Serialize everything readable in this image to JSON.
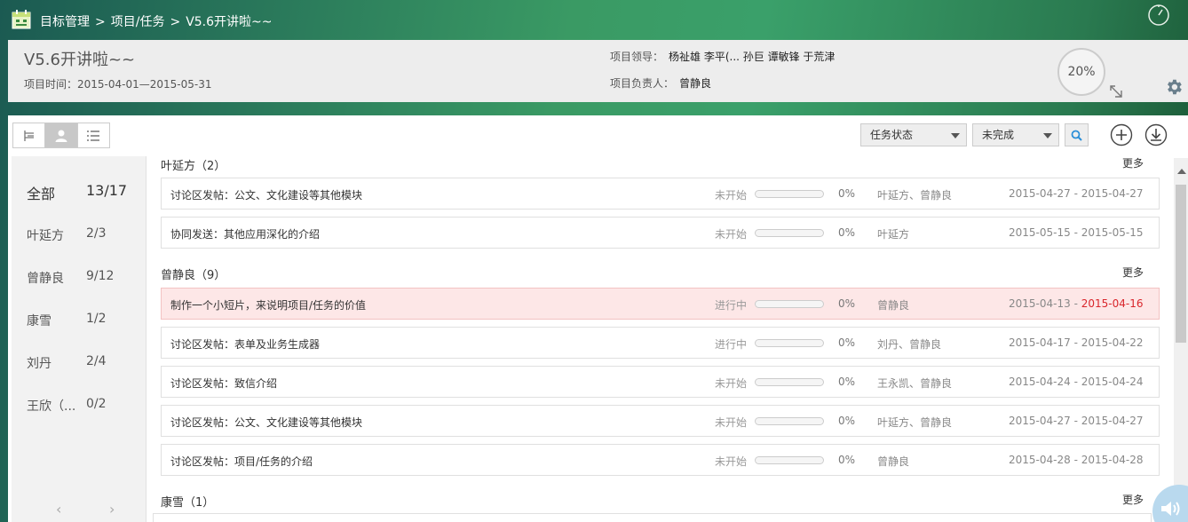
{
  "breadcrumb": {
    "root": "目标管理",
    "sep1": ">",
    "mid": "项目/任务",
    "sep2": ">",
    "current": "V5.6开讲啦~~"
  },
  "header": {
    "title": "V5.6开讲啦~~",
    "time": "项目时间：2015-04-01—2015-05-31",
    "leaders_label": "项目领导：",
    "leaders": "杨祉雄 李平(... 孙巨 谭敏锋 于荒津",
    "owner_label": "项目负责人：",
    "owner": "曾静良",
    "progress": "20%"
  },
  "toolbar": {
    "status_filter": "任务状态",
    "done_filter": "未完成"
  },
  "sidebar": {
    "items": [
      {
        "name": "全部",
        "count": "13/17"
      },
      {
        "name": "叶延方",
        "count": "2/3"
      },
      {
        "name": "曾静良",
        "count": "9/12"
      },
      {
        "name": "康雪",
        "count": "1/2"
      },
      {
        "name": "刘丹",
        "count": "2/4"
      },
      {
        "name": "王欣（...",
        "count": "0/2"
      }
    ],
    "prev": "‹",
    "next": "›"
  },
  "groups": [
    {
      "title": "叶延方（2）",
      "more": "更多",
      "rows": [
        {
          "name": "讨论区发帖：公文、文化建设等其他模块",
          "state": "未开始",
          "progress": 0,
          "pct": "0%",
          "who": "叶延方、曾静良",
          "start": "2015-04-27",
          "dash": "-",
          "end": "2015-04-27"
        },
        {
          "name": "协同发送：其他应用深化的介绍",
          "state": "未开始",
          "progress": 0,
          "pct": "0%",
          "who": "叶延方",
          "start": "2015-05-15",
          "dash": "-",
          "end": "2015-05-15"
        }
      ]
    },
    {
      "title": "曾静良（9）",
      "more": "更多",
      "rows": [
        {
          "name": "制作一个小短片，来说明项目/任务的价值",
          "state": "进行中",
          "progress": 0,
          "pct": "0%",
          "who": "曾静良",
          "start": "2015-04-13",
          "dash": "-",
          "end": "2015-04-16",
          "overdue": true
        },
        {
          "name": "讨论区发帖：表单及业务生成器",
          "state": "进行中",
          "progress": 0,
          "pct": "0%",
          "who": "刘丹、曾静良",
          "start": "2015-04-17",
          "dash": "-",
          "end": "2015-04-22"
        },
        {
          "name": "讨论区发帖：致信介绍",
          "state": "未开始",
          "progress": 0,
          "pct": "0%",
          "who": "王永凯、曾静良",
          "start": "2015-04-24",
          "dash": "-",
          "end": "2015-04-24"
        },
        {
          "name": "讨论区发帖：公文、文化建设等其他模块",
          "state": "未开始",
          "progress": 0,
          "pct": "0%",
          "who": "叶延方、曾静良",
          "start": "2015-04-27",
          "dash": "-",
          "end": "2015-04-27"
        },
        {
          "name": "讨论区发帖：项目/任务的介绍",
          "state": "未开始",
          "progress": 0,
          "pct": "0%",
          "who": "曾静良",
          "start": "2015-04-28",
          "dash": "-",
          "end": "2015-04-28"
        }
      ]
    },
    {
      "title": "康雪（1）",
      "more": "更多",
      "rows": []
    }
  ],
  "colors": {
    "accent": "#3aa06a",
    "overdue": "#d9262c",
    "alert_row": "#fde7e7"
  }
}
